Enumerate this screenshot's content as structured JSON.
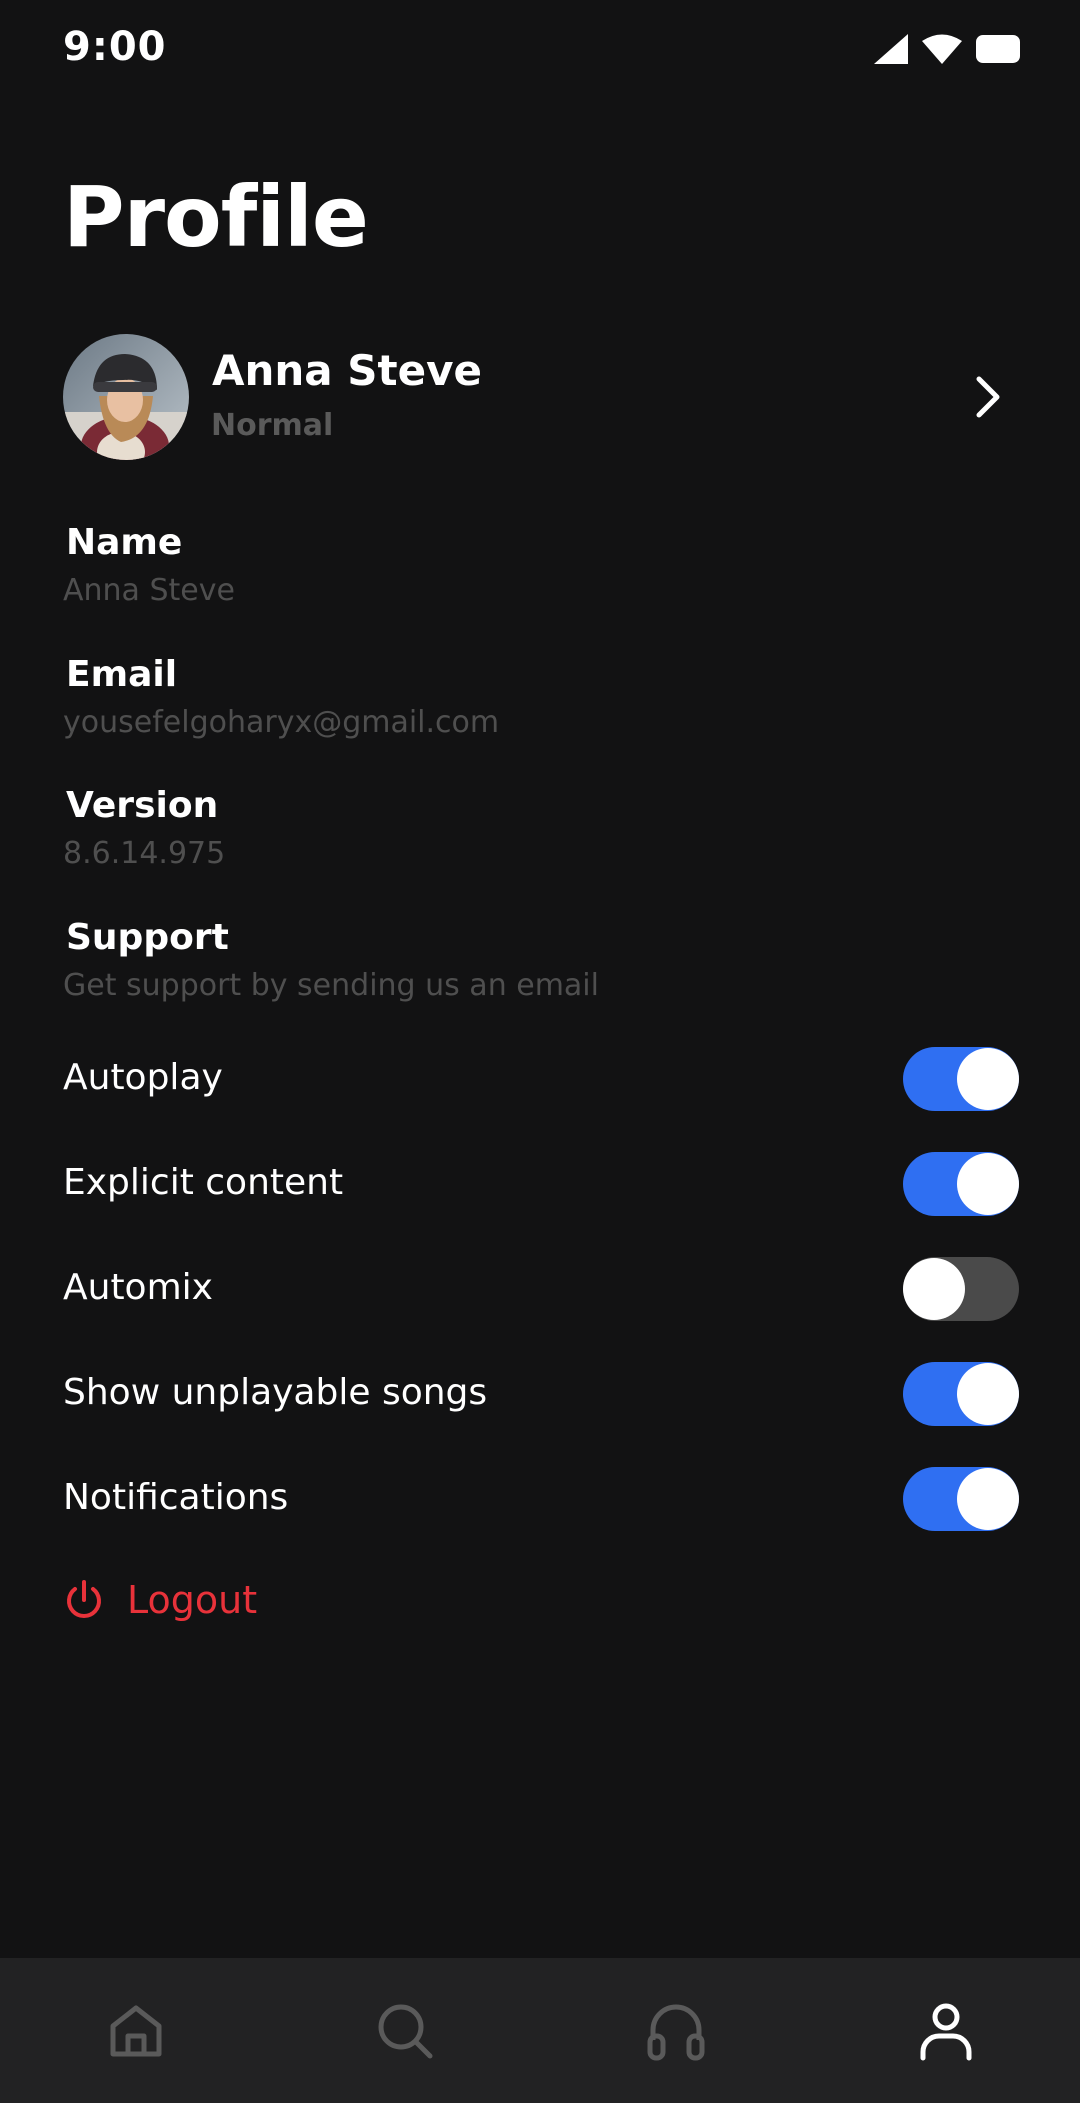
{
  "status_bar": {
    "time": "9:00",
    "icons": [
      "cellular-signal-icon",
      "wifi-icon",
      "battery-icon"
    ]
  },
  "page": {
    "title": "Profile"
  },
  "profile": {
    "name": "Anna Steve",
    "tier": "Normal",
    "avatar": "avatar-photo",
    "chevron_icon": "chevron-right-icon"
  },
  "info": [
    {
      "label": "Name",
      "value": "Anna Steve"
    },
    {
      "label": "Email",
      "value": "yousefelgoharyx@gmail.com"
    },
    {
      "label": "Version",
      "value": "8.6.14.975"
    },
    {
      "label": "Support",
      "value": "Get support by sending us an email"
    }
  ],
  "toggles": [
    {
      "label": "Autoplay",
      "on": true
    },
    {
      "label": "Explicit content",
      "on": true
    },
    {
      "label": "Automix",
      "on": false
    },
    {
      "label": "Show unplayable songs",
      "on": true
    },
    {
      "label": "Notifications",
      "on": true
    }
  ],
  "logout": {
    "label": "Logout",
    "icon": "power-icon",
    "color": "#e8323a"
  },
  "bottom_nav": {
    "items": [
      {
        "icon": "home-icon",
        "active": false
      },
      {
        "icon": "search-icon",
        "active": false
      },
      {
        "icon": "headphones-icon",
        "active": false
      },
      {
        "icon": "profile-icon",
        "active": true
      }
    ]
  },
  "colors": {
    "background": "#121213",
    "accent": "#2f6ff2",
    "muted_text": "#4f4f4f",
    "danger": "#e8323a",
    "nav_background": "#222223"
  }
}
